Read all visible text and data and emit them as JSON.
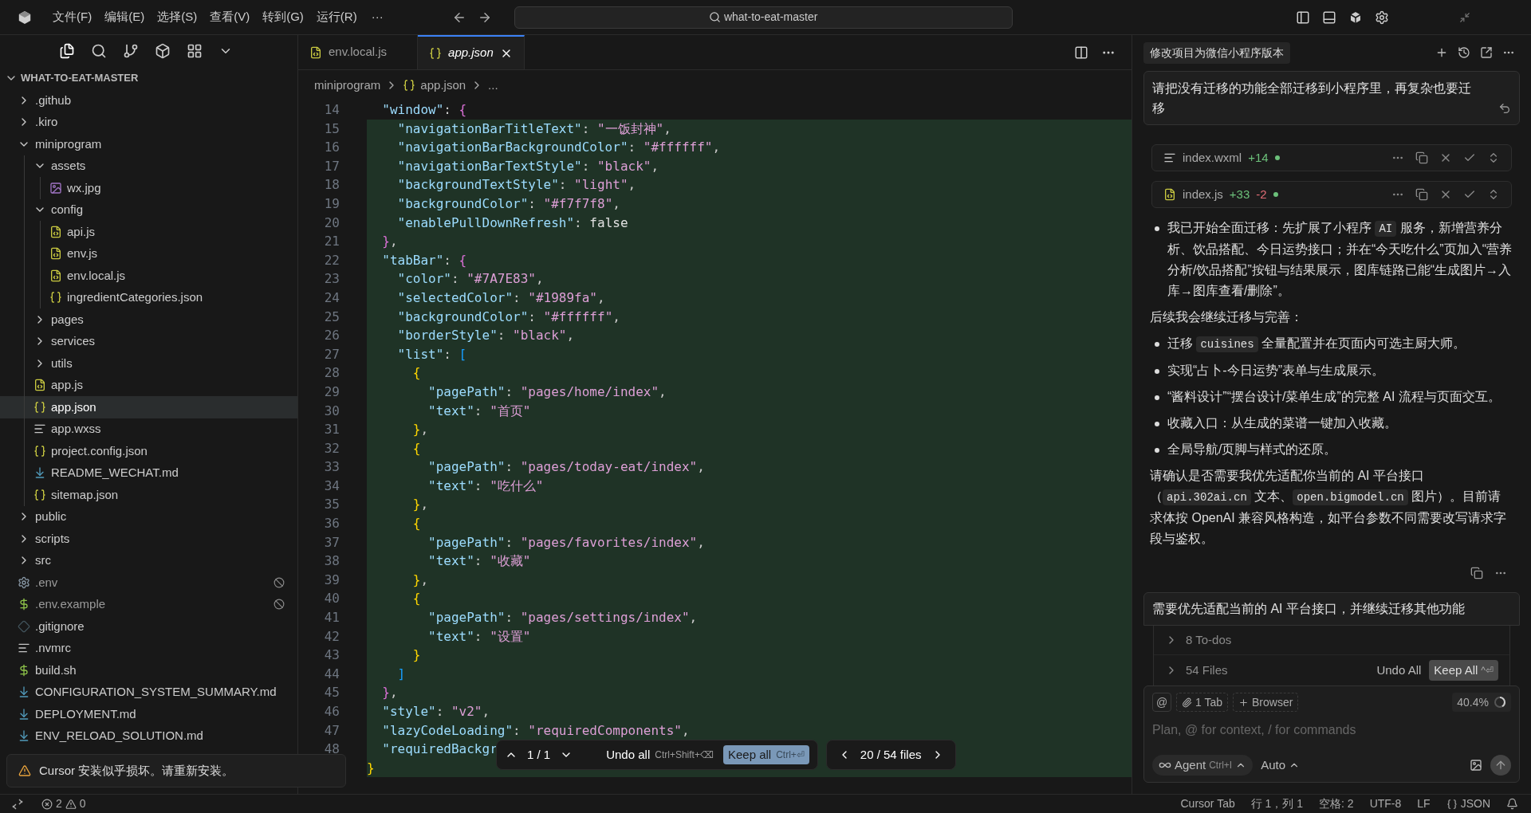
{
  "titlebar": {
    "menus": [
      "文件(F)",
      "编辑(E)",
      "选择(S)",
      "查看(V)",
      "转到(G)",
      "运行(R)"
    ],
    "more": "···",
    "search": "what-to-eat-master"
  },
  "explorer": {
    "title": "WHAT-TO-EAT-MASTER",
    "tree": [
      {
        "name": ".github",
        "kind": "folder",
        "expanded": false,
        "selected": false,
        "ignored": false
      },
      {
        "name": ".kiro",
        "kind": "folder",
        "expanded": false,
        "selected": false,
        "ignored": false
      },
      {
        "name": "miniprogram",
        "kind": "folder",
        "expanded": true,
        "selected": false,
        "ignored": false,
        "children": [
          {
            "name": "assets",
            "kind": "folder",
            "expanded": true,
            "selected": false,
            "ignored": false,
            "children": [
              {
                "name": "wx.jpg",
                "kind": "image",
                "selected": false,
                "ignored": false
              }
            ]
          },
          {
            "name": "config",
            "kind": "folder",
            "expanded": true,
            "selected": false,
            "ignored": false,
            "children": [
              {
                "name": "api.js",
                "kind": "js",
                "selected": false,
                "ignored": false
              },
              {
                "name": "env.js",
                "kind": "js",
                "selected": false,
                "ignored": false
              },
              {
                "name": "env.local.js",
                "kind": "js",
                "selected": false,
                "ignored": false
              },
              {
                "name": "ingredientCategories.json",
                "kind": "json",
                "selected": false,
                "ignored": false
              }
            ]
          },
          {
            "name": "pages",
            "kind": "folder",
            "expanded": false,
            "selected": false,
            "ignored": false
          },
          {
            "name": "services",
            "kind": "folder",
            "expanded": false,
            "selected": false,
            "ignored": false
          },
          {
            "name": "utils",
            "kind": "folder",
            "expanded": false,
            "selected": false,
            "ignored": false
          },
          {
            "name": "app.js",
            "kind": "js",
            "selected": false,
            "ignored": false
          },
          {
            "name": "app.json",
            "kind": "json",
            "selected": true,
            "ignored": false
          },
          {
            "name": "app.wxss",
            "kind": "lines",
            "selected": false,
            "ignored": false
          },
          {
            "name": "project.config.json",
            "kind": "json",
            "selected": false,
            "ignored": false
          },
          {
            "name": "README_WECHAT.md",
            "kind": "md",
            "selected": false,
            "ignored": false
          },
          {
            "name": "sitemap.json",
            "kind": "json",
            "selected": false,
            "ignored": false
          }
        ]
      },
      {
        "name": "public",
        "kind": "folder",
        "expanded": false,
        "selected": false,
        "ignored": false
      },
      {
        "name": "scripts",
        "kind": "folder",
        "expanded": false,
        "selected": false,
        "ignored": false
      },
      {
        "name": "src",
        "kind": "folder",
        "expanded": false,
        "selected": false,
        "ignored": false
      },
      {
        "name": ".env",
        "kind": "gear",
        "selected": false,
        "ignored": true
      },
      {
        "name": ".env.example",
        "kind": "dollar",
        "selected": false,
        "ignored": true
      },
      {
        "name": ".gitignore",
        "kind": "git",
        "selected": false,
        "ignored": false
      },
      {
        "name": ".nvmrc",
        "kind": "lines",
        "selected": false,
        "ignored": false
      },
      {
        "name": "build.sh",
        "kind": "dollar",
        "selected": false,
        "ignored": false
      },
      {
        "name": "CONFIGURATION_SYSTEM_SUMMARY.md",
        "kind": "md",
        "selected": false,
        "ignored": false
      },
      {
        "name": "DEPLOYMENT.md",
        "kind": "md",
        "selected": false,
        "ignored": false
      },
      {
        "name": "ENV_RELOAD_SOLUTION.md",
        "kind": "md",
        "selected": false,
        "ignored": false
      }
    ]
  },
  "editor": {
    "tabs": [
      {
        "label": "env.local.js",
        "kind": "js",
        "selected": false
      },
      {
        "label": "app.json",
        "kind": "json",
        "selected": true
      }
    ],
    "breadcrumb": [
      {
        "label": "miniprogram",
        "kind": "folder"
      },
      {
        "label": "app.json",
        "kind": "json"
      },
      {
        "label": "...",
        "kind": "more"
      }
    ],
    "lines": [
      {
        "num": "14",
        "changed": false,
        "tokens": [
          {
            "kind": "key",
            "text": "\"window\""
          },
          {
            "kind": "punct",
            "text": ": "
          },
          {
            "kind": "open",
            "text": "{"
          }
        ]
      },
      {
        "num": "15",
        "changed": true,
        "tokens": [
          {
            "kind": "key",
            "text": "\"navigationBarTitleText\""
          },
          {
            "kind": "punct",
            "text": ": "
          },
          {
            "kind": "str",
            "text": "\"一饭封神\""
          },
          {
            "kind": "punct",
            "text": ","
          }
        ]
      },
      {
        "num": "16",
        "changed": true,
        "tokens": [
          {
            "kind": "key",
            "text": "\"navigationBarBackgroundColor\""
          },
          {
            "kind": "punct",
            "text": ": "
          },
          {
            "kind": "str",
            "text": "\"#ffffff\""
          },
          {
            "kind": "punct",
            "text": ","
          }
        ]
      },
      {
        "num": "17",
        "changed": true,
        "tokens": [
          {
            "kind": "key",
            "text": "\"navigationBarTextStyle\""
          },
          {
            "kind": "punct",
            "text": ": "
          },
          {
            "kind": "str",
            "text": "\"black\""
          },
          {
            "kind": "punct",
            "text": ","
          }
        ]
      },
      {
        "num": "18",
        "changed": true,
        "tokens": [
          {
            "kind": "key",
            "text": "\"backgroundTextStyle\""
          },
          {
            "kind": "punct",
            "text": ": "
          },
          {
            "kind": "str",
            "text": "\"light\""
          },
          {
            "kind": "punct",
            "text": ","
          }
        ]
      },
      {
        "num": "19",
        "changed": true,
        "tokens": [
          {
            "kind": "key",
            "text": "\"backgroundColor\""
          },
          {
            "kind": "punct",
            "text": ": "
          },
          {
            "kind": "str",
            "text": "\"#f7f7f8\""
          },
          {
            "kind": "punct",
            "text": ","
          }
        ]
      },
      {
        "num": "20",
        "changed": true,
        "tokens": [
          {
            "kind": "key",
            "text": "\"enablePullDownRefresh\""
          },
          {
            "kind": "punct",
            "text": ": "
          },
          {
            "kind": "kw",
            "text": "false"
          }
        ]
      },
      {
        "num": "21",
        "changed": true,
        "tokens": [
          {
            "kind": "close",
            "text": "}"
          },
          {
            "kind": "punct",
            "text": ","
          }
        ]
      },
      {
        "num": "22",
        "changed": true,
        "tokens": [
          {
            "kind": "key",
            "text": "\"tabBar\""
          },
          {
            "kind": "punct",
            "text": ": "
          },
          {
            "kind": "open",
            "text": "{"
          }
        ]
      },
      {
        "num": "23",
        "changed": true,
        "tokens": [
          {
            "kind": "key",
            "text": "\"color\""
          },
          {
            "kind": "punct",
            "text": ": "
          },
          {
            "kind": "str",
            "text": "\"#7A7E83\""
          },
          {
            "kind": "punct",
            "text": ","
          }
        ]
      },
      {
        "num": "24",
        "changed": true,
        "tokens": [
          {
            "kind": "key",
            "text": "\"selectedColor\""
          },
          {
            "kind": "punct",
            "text": ": "
          },
          {
            "kind": "str",
            "text": "\"#1989fa\""
          },
          {
            "kind": "punct",
            "text": ","
          }
        ]
      },
      {
        "num": "25",
        "changed": true,
        "tokens": [
          {
            "kind": "key",
            "text": "\"backgroundColor\""
          },
          {
            "kind": "punct",
            "text": ": "
          },
          {
            "kind": "str",
            "text": "\"#ffffff\""
          },
          {
            "kind": "punct",
            "text": ","
          }
        ]
      },
      {
        "num": "26",
        "changed": true,
        "tokens": [
          {
            "kind": "key",
            "text": "\"borderStyle\""
          },
          {
            "kind": "punct",
            "text": ": "
          },
          {
            "kind": "str",
            "text": "\"black\""
          },
          {
            "kind": "punct",
            "text": ","
          }
        ]
      },
      {
        "num": "27",
        "changed": true,
        "tokens": [
          {
            "kind": "key",
            "text": "\"list\""
          },
          {
            "kind": "punct",
            "text": ": "
          },
          {
            "kind": "open",
            "text": "["
          }
        ]
      },
      {
        "num": "28",
        "changed": true,
        "tokens": [
          {
            "kind": "open",
            "text": "{"
          }
        ]
      },
      {
        "num": "29",
        "changed": true,
        "tokens": [
          {
            "kind": "key",
            "text": "\"pagePath\""
          },
          {
            "kind": "punct",
            "text": ": "
          },
          {
            "kind": "str",
            "text": "\"pages/home/index\""
          },
          {
            "kind": "punct",
            "text": ","
          }
        ]
      },
      {
        "num": "30",
        "changed": true,
        "tokens": [
          {
            "kind": "key",
            "text": "\"text\""
          },
          {
            "kind": "punct",
            "text": ": "
          },
          {
            "kind": "str",
            "text": "\"首页\""
          }
        ]
      },
      {
        "num": "31",
        "changed": true,
        "tokens": [
          {
            "kind": "close",
            "text": "}"
          },
          {
            "kind": "punct",
            "text": ","
          }
        ]
      },
      {
        "num": "32",
        "changed": true,
        "tokens": [
          {
            "kind": "open",
            "text": "{"
          }
        ]
      },
      {
        "num": "33",
        "changed": true,
        "tokens": [
          {
            "kind": "key",
            "text": "\"pagePath\""
          },
          {
            "kind": "punct",
            "text": ": "
          },
          {
            "kind": "str",
            "text": "\"pages/today-eat/index\""
          },
          {
            "kind": "punct",
            "text": ","
          }
        ]
      },
      {
        "num": "34",
        "changed": true,
        "tokens": [
          {
            "kind": "key",
            "text": "\"text\""
          },
          {
            "kind": "punct",
            "text": ": "
          },
          {
            "kind": "str",
            "text": "\"吃什么\""
          }
        ]
      },
      {
        "num": "35",
        "changed": true,
        "tokens": [
          {
            "kind": "close",
            "text": "}"
          },
          {
            "kind": "punct",
            "text": ","
          }
        ]
      },
      {
        "num": "36",
        "changed": true,
        "tokens": [
          {
            "kind": "open",
            "text": "{"
          }
        ]
      },
      {
        "num": "37",
        "changed": true,
        "tokens": [
          {
            "kind": "key",
            "text": "\"pagePath\""
          },
          {
            "kind": "punct",
            "text": ": "
          },
          {
            "kind": "str",
            "text": "\"pages/favorites/index\""
          },
          {
            "kind": "punct",
            "text": ","
          }
        ]
      },
      {
        "num": "38",
        "changed": true,
        "tokens": [
          {
            "kind": "key",
            "text": "\"text\""
          },
          {
            "kind": "punct",
            "text": ": "
          },
          {
            "kind": "str",
            "text": "\"收藏\""
          }
        ]
      },
      {
        "num": "39",
        "changed": true,
        "tokens": [
          {
            "kind": "close",
            "text": "}"
          },
          {
            "kind": "punct",
            "text": ","
          }
        ]
      },
      {
        "num": "40",
        "changed": true,
        "tokens": [
          {
            "kind": "open",
            "text": "{"
          }
        ]
      },
      {
        "num": "41",
        "changed": true,
        "tokens": [
          {
            "kind": "key",
            "text": "\"pagePath\""
          },
          {
            "kind": "punct",
            "text": ": "
          },
          {
            "kind": "str",
            "text": "\"pages/settings/index\""
          },
          {
            "kind": "punct",
            "text": ","
          }
        ]
      },
      {
        "num": "42",
        "changed": true,
        "tokens": [
          {
            "kind": "key",
            "text": "\"text\""
          },
          {
            "kind": "punct",
            "text": ": "
          },
          {
            "kind": "str",
            "text": "\"设置\""
          }
        ]
      },
      {
        "num": "43",
        "changed": true,
        "tokens": [
          {
            "kind": "close",
            "text": "}"
          }
        ]
      },
      {
        "num": "44",
        "changed": true,
        "tokens": [
          {
            "kind": "close",
            "text": "]"
          }
        ]
      },
      {
        "num": "45",
        "changed": true,
        "tokens": [
          {
            "kind": "close",
            "text": "}"
          },
          {
            "kind": "punct",
            "text": ","
          }
        ]
      },
      {
        "num": "46",
        "changed": true,
        "tokens": [
          {
            "kind": "key",
            "text": "\"style\""
          },
          {
            "kind": "punct",
            "text": ": "
          },
          {
            "kind": "str",
            "text": "\"v2\""
          },
          {
            "kind": "punct",
            "text": ","
          }
        ]
      },
      {
        "num": "47",
        "changed": true,
        "tokens": [
          {
            "kind": "key",
            "text": "\"lazyCodeLoading\""
          },
          {
            "kind": "punct",
            "text": ": "
          },
          {
            "kind": "str",
            "text": "\"requiredComponents\""
          },
          {
            "kind": "punct",
            "text": ","
          }
        ]
      },
      {
        "num": "48",
        "changed": true,
        "tokens": [
          {
            "kind": "key",
            "text": "\"requiredBackgr"
          }
        ]
      },
      {
        "changed": true,
        "tokens": [
          {
            "kind": "close",
            "text": "}"
          }
        ]
      }
    ],
    "review_bar": {
      "counter": "1 / 1",
      "undo": "Undo all",
      "undo_shortcut": "Ctrl+Shift+⌫",
      "keep": "Keep all",
      "keep_shortcut": "Ctrl+⏎",
      "files": "20 / 54 files"
    }
  },
  "toast": {
    "message": "Cursor 安装似乎损坏。请重新安装。"
  },
  "chat": {
    "title": "修改项目为微信小程序版本",
    "first_message": "请把没有迁移的功能全部迁移到小程序里，再复杂也要迁移",
    "file_changes": [
      {
        "name": "index.wxml",
        "kind": "lines",
        "added": "+14"
      },
      {
        "name": "index.js",
        "kind": "js",
        "added": "+33",
        "removed": "-2"
      }
    ],
    "reply": [
      {
        "kind": "bullet",
        "segments": [
          {
            "kind": "text",
            "text": "我已开始全面迁移：先扩展了小程序 "
          },
          {
            "kind": "code",
            "text": "AI"
          },
          {
            "kind": "text",
            "text": " 服务，新增营养分析、饮品搭配、今日运势接口；并在“今天吃什么”页加入“营养分析/饮品搭配”按钮与结果展示，图库链路已能“生成图片→入库→图库查看/删除”。"
          }
        ]
      },
      {
        "kind": "para",
        "segments": [
          {
            "kind": "text",
            "text": "后续我会继续迁移与完善："
          }
        ]
      },
      {
        "kind": "bullet",
        "segments": [
          {
            "kind": "text",
            "text": "迁移 "
          },
          {
            "kind": "code",
            "text": "cuisines"
          },
          {
            "kind": "text",
            "text": " 全量配置并在页面内可选主厨大师。"
          }
        ]
      },
      {
        "kind": "bullet",
        "segments": [
          {
            "kind": "text",
            "text": "实现“占卜-今日运势”表单与生成展示。"
          }
        ]
      },
      {
        "kind": "bullet",
        "segments": [
          {
            "kind": "text",
            "text": "“酱料设计”“摆台设计/菜单生成”的完整 AI 流程与页面交互。"
          }
        ]
      },
      {
        "kind": "bullet",
        "segments": [
          {
            "kind": "text",
            "text": "收藏入口：从生成的菜谱一键加入收藏。"
          }
        ]
      },
      {
        "kind": "bullet",
        "segments": [
          {
            "kind": "text",
            "text": "全局导航/页脚与样式的还原。"
          }
        ]
      },
      {
        "kind": "para",
        "segments": [
          {
            "kind": "text",
            "text": "请确认是否需要我优先适配你当前的 AI 平台接口（"
          },
          {
            "kind": "code",
            "text": "api.302ai.cn"
          },
          {
            "kind": "text",
            "text": " 文本、"
          },
          {
            "kind": "code",
            "text": "open.bigmodel.cn"
          },
          {
            "kind": "text",
            "text": " 图片）。目前请求体按 OpenAI 兼容风格构造，如平台参数不同需要改写请求字段与鉴权。"
          }
        ]
      }
    ],
    "second_message": "需要优先适配当前的 AI 平台接口，并继续迁移其他功能",
    "todos": "8 To-dos",
    "files": "54 Files",
    "undo_all": "Undo All",
    "keep_all": "Keep All",
    "keep_shortcut": "^⏎",
    "composer": {
      "at": "@",
      "tab_chip": "1 Tab",
      "browser_chip": "Browser",
      "context": "40.4%",
      "level": 0.404,
      "placeholder": "Plan, @ for context, / for commands",
      "mode": "Agent",
      "mode_shortcut": "Ctrl+I",
      "model": "Auto"
    }
  },
  "status_bar": {
    "errors": "2",
    "warnings": "0",
    "items": [
      "Cursor Tab",
      "行 1，列 1",
      "空格: 2",
      "UTF-8",
      "LF"
    ],
    "language": "JSON"
  }
}
